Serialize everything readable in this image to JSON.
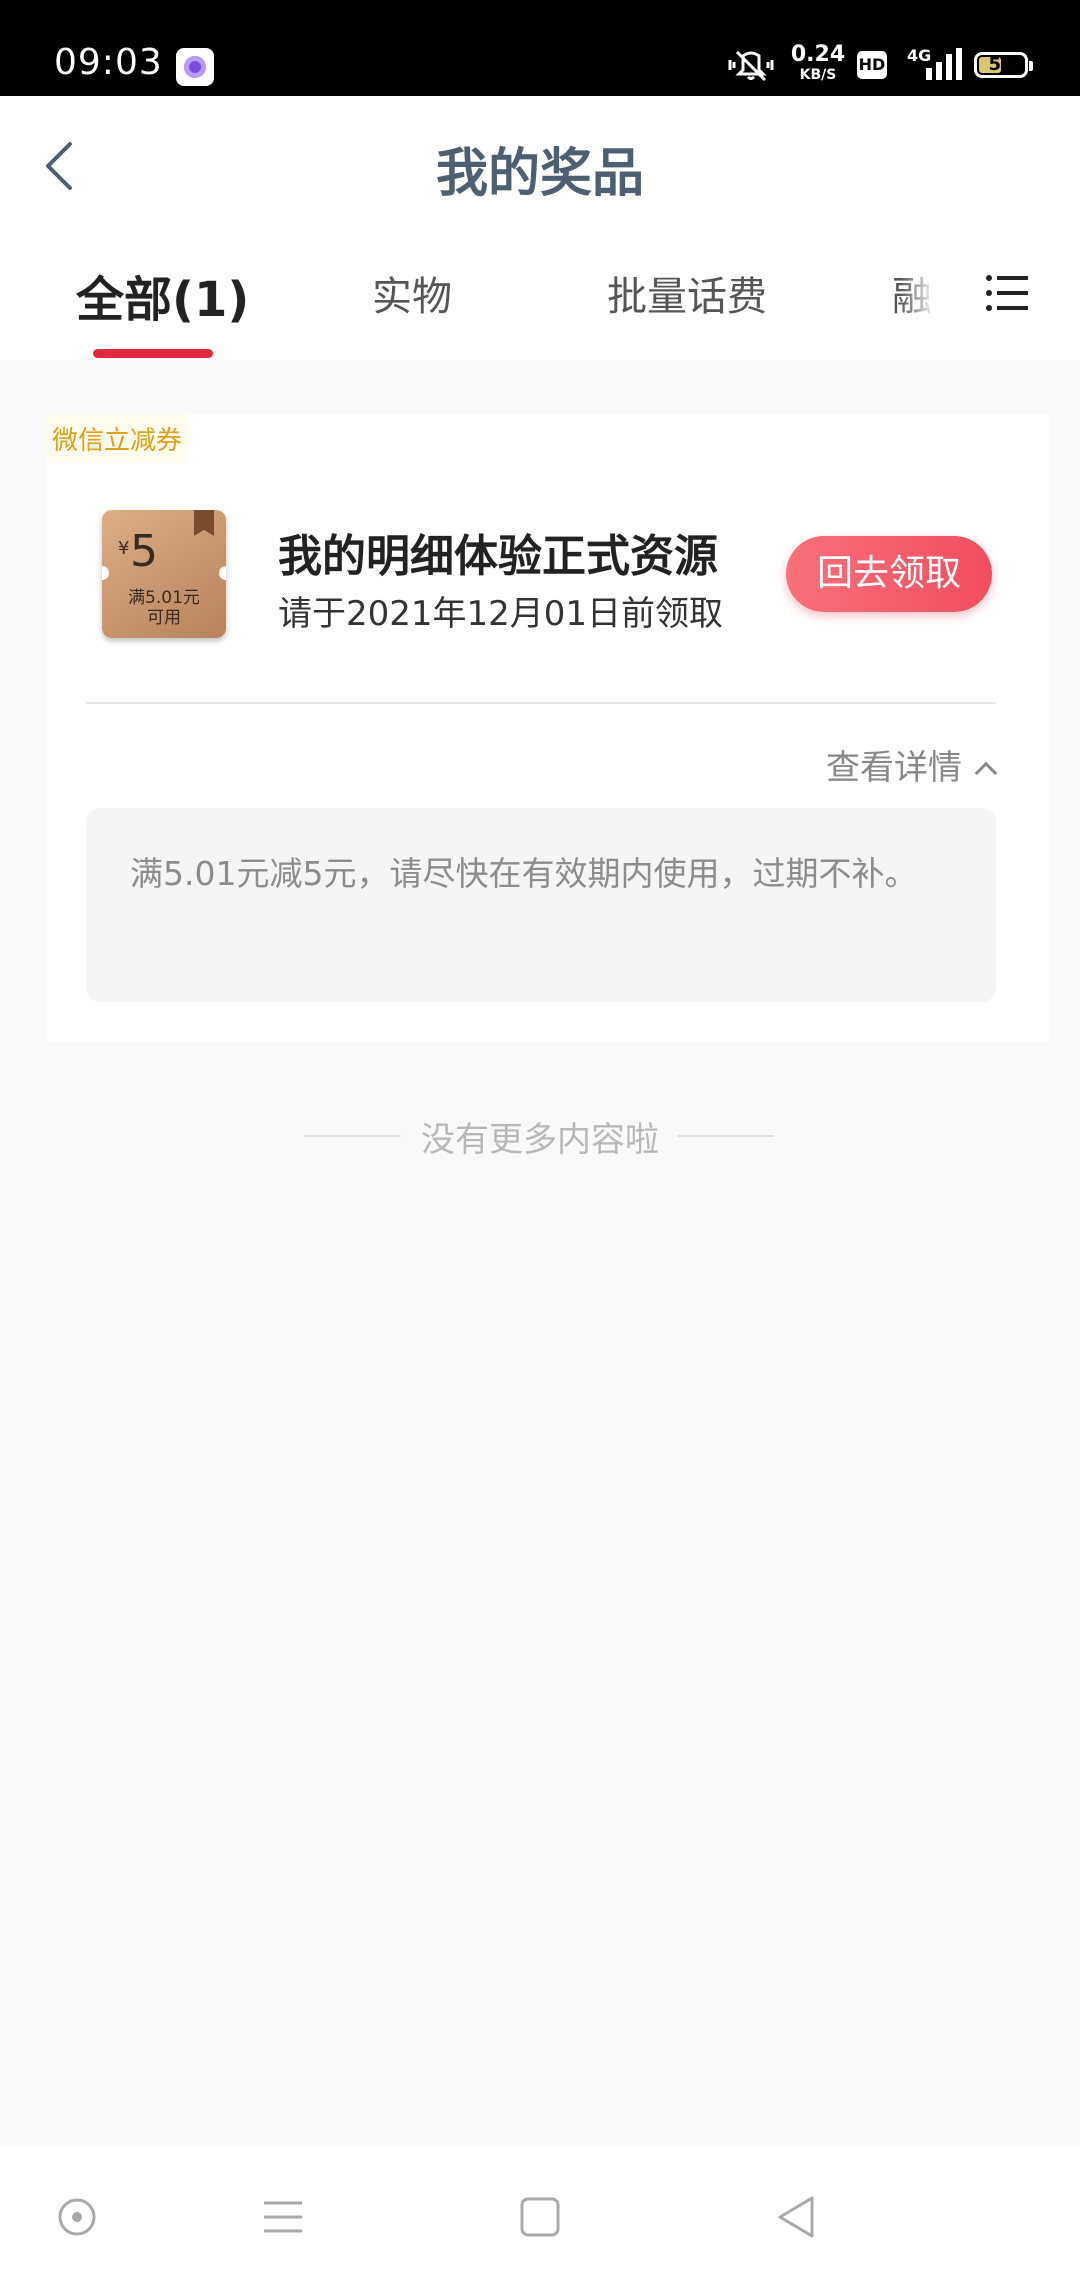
{
  "status_bar": {
    "time": "09:03",
    "network_speed_value": "0.24",
    "network_speed_unit": "KB/S",
    "hd_label": "HD",
    "network_type": "4G",
    "battery_level": "51",
    "battery_fraction": 0.51
  },
  "header": {
    "title": "我的奖品"
  },
  "tabs": [
    {
      "label": "全部(1)",
      "active": true
    },
    {
      "label": "实物",
      "active": false
    },
    {
      "label": "批量话费",
      "active": false
    },
    {
      "label": "融",
      "active": false
    }
  ],
  "prize_card": {
    "tag": "微信立减券",
    "coupon": {
      "currency": "¥",
      "amount": "5",
      "condition_line1": "满5.01元",
      "condition_line2": "可用"
    },
    "name": "我的明细体验正式资源",
    "deadline": "请于2021年12月01日前领取",
    "claim_button": "回去领取",
    "details_toggle": "查看详情",
    "details_text": "满5.01元减5元，请尽快在有效期内使用，过期不补。"
  },
  "footer_note": "没有更多内容啦",
  "icons": {
    "back": "back-arrow-icon",
    "menu": "list-menu-icon",
    "nav_home": "circle-dot-icon",
    "nav_recent": "hamburger-icon",
    "nav_square": "square-icon",
    "nav_back": "triangle-back-icon"
  },
  "colors": {
    "accent": "#e4283b",
    "claim_button": "#f14e5d",
    "tag_text": "#dfa019",
    "title": "#4d5f70"
  }
}
